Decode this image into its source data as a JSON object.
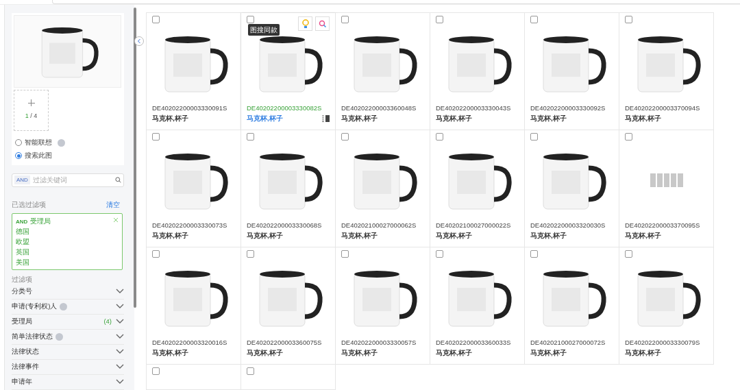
{
  "sidebar": {
    "upload": {
      "counter_current": "1",
      "counter_total": "/ 4"
    },
    "search_modes": [
      {
        "label": "智能联想",
        "selected": false,
        "info": true
      },
      {
        "label": "搜索此图",
        "selected": true
      }
    ],
    "keyword_filter": {
      "operator": "AND",
      "placeholder": "过滤关键词"
    },
    "selected_filters": {
      "title": "已选过滤项",
      "clear": "清空",
      "group": {
        "operator": "AND",
        "field": "受理局",
        "values": [
          "德国",
          "欧盟",
          "英国",
          "美国"
        ]
      }
    },
    "filters": {
      "title": "过滤项",
      "items": [
        {
          "label": "分类号",
          "info": false
        },
        {
          "label": "申请(专利权)人",
          "info": true
        },
        {
          "label": "受理局",
          "info": false,
          "count": "(4)"
        },
        {
          "label": "简单法律状态",
          "info": true
        },
        {
          "label": "法律状态",
          "info": false
        },
        {
          "label": "法律事件",
          "info": false
        },
        {
          "label": "申请年",
          "info": false
        }
      ]
    }
  },
  "results": [
    {
      "id": "DE40202200003330091S",
      "title": "马克杯,杯子",
      "hovered": false,
      "checked": false
    },
    {
      "id": "DE40202200003330082S",
      "title": "马克杯,杯子",
      "hovered": true,
      "checked": false,
      "tooltip": "图搜同款"
    },
    {
      "id": "DE40202200003360048S",
      "title": "马克杯,杯子",
      "hovered": false,
      "checked": false
    },
    {
      "id": "DE40202200003330043S",
      "title": "马克杯,杯子",
      "hovered": false,
      "checked": false
    },
    {
      "id": "DE40202200003330092S",
      "title": "马克杯,杯子",
      "hovered": false,
      "checked": false
    },
    {
      "id": "DE40202200003370094S",
      "title": "马克杯,杯子",
      "hovered": false,
      "checked": false
    },
    {
      "id": "DE40202200003330073S",
      "title": "马克杯,杯子",
      "hovered": false,
      "checked": false
    },
    {
      "id": "DE40202200003330068S",
      "title": "马克杯,杯子",
      "hovered": false,
      "checked": false
    },
    {
      "id": "DE40202100027000062S",
      "title": "马克杯,杯子",
      "hovered": false,
      "checked": false
    },
    {
      "id": "DE40202100027000022S",
      "title": "马克杯,杯子",
      "hovered": false,
      "checked": false
    },
    {
      "id": "DE40202200003320030S",
      "title": "马克杯,杯子",
      "hovered": false,
      "checked": false
    },
    {
      "id": "DE40202200003370095S",
      "title": "马克杯,杯子",
      "hovered": false,
      "checked": false,
      "loading": true
    },
    {
      "id": "DE40202200003320016S",
      "title": "马克杯,杯子",
      "hovered": false,
      "checked": false
    },
    {
      "id": "DE40202200003360075S",
      "title": "马克杯,杯子",
      "hovered": false,
      "checked": false
    },
    {
      "id": "DE40202200003330057S",
      "title": "马克杯,杯子",
      "hovered": false,
      "checked": false
    },
    {
      "id": "DE40202200003360033S",
      "title": "马克杯,杯子",
      "hovered": false,
      "checked": false
    },
    {
      "id": "DE40202100027000072S",
      "title": "马克杯,杯子",
      "hovered": false,
      "checked": false
    },
    {
      "id": "DE40202200003330079S",
      "title": "马克杯,杯子",
      "hovered": false,
      "checked": false
    },
    {
      "hovered": false,
      "checked": false
    },
    {
      "hovered": false,
      "checked": false
    }
  ]
}
